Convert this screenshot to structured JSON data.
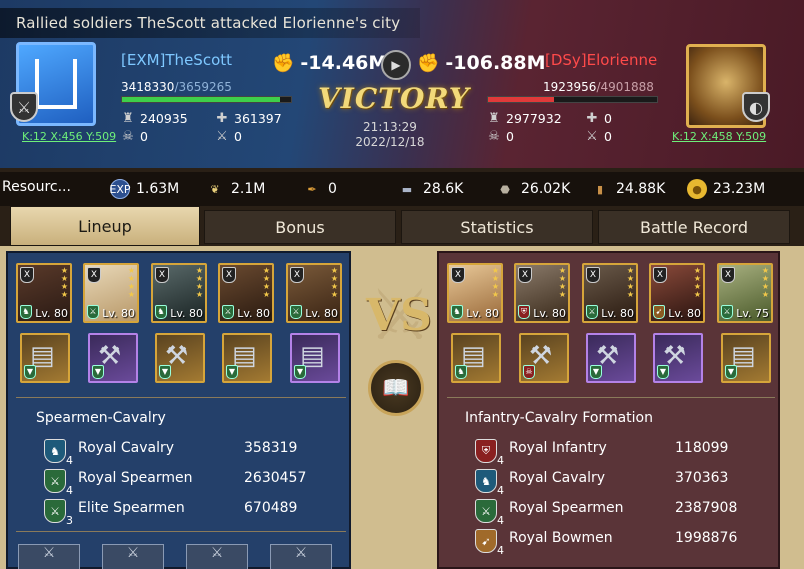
{
  "header": {
    "title": "Rallied soldiers TheScott attacked Elorienne's city",
    "result": "VICTORY",
    "time": "21:13:29",
    "date": "2022/12/18",
    "left": {
      "name": "[EXM]TheScott",
      "coord": "K:12 X:456 Y:509",
      "hp_current": "3418330",
      "hp_max": "/3659265",
      "hp_fraction": 0.934,
      "power": "-14.46M",
      "stat1": "240935",
      "stat2": "361397",
      "stat3": "0",
      "stat4": "0",
      "name_color": "#7ec8ff",
      "bar_color": "#3ecf4a"
    },
    "right": {
      "name": "[DSy]Elorienne",
      "coord": "K:12 X:458 Y:509",
      "hp_current": "1923956",
      "hp_max": "/4901888",
      "hp_fraction": 0.392,
      "power": "-106.88M",
      "stat1": "2977932",
      "stat2": "0",
      "stat3": "0",
      "stat4": "0",
      "name_color": "#ff4a4a",
      "bar_color": "#e03a3a"
    }
  },
  "resources": {
    "label": "Resourc...",
    "items": [
      {
        "icon": "exp-icon",
        "value": "1.63M"
      },
      {
        "icon": "laurel-icon",
        "value": "2.1M"
      },
      {
        "icon": "feather-icon",
        "value": "0"
      },
      {
        "icon": "iron-icon",
        "value": "28.6K"
      },
      {
        "icon": "stone-icon",
        "value": "26.02K"
      },
      {
        "icon": "wood-icon",
        "value": "24.88K"
      },
      {
        "icon": "gold-icon",
        "value": "23.23M"
      }
    ]
  },
  "tabs": [
    "Lineup",
    "Bonus",
    "Statistics",
    "Battle Record"
  ],
  "lineup": {
    "left": {
      "heroes": [
        {
          "level": "Lv. 80"
        },
        {
          "level": "Lv. 80"
        },
        {
          "level": "Lv. 80"
        },
        {
          "level": "Lv. 80"
        },
        {
          "level": "Lv. 80"
        }
      ],
      "formation": "Spearmen-Cavalry",
      "troops": [
        {
          "tier": "4",
          "name": "Royal Cavalry",
          "count": "358319",
          "icon": "cavalry-icon"
        },
        {
          "tier": "4",
          "name": "Royal Spearmen",
          "count": "2630457",
          "icon": "spearmen-icon"
        },
        {
          "tier": "3",
          "name": "Elite Spearmen",
          "count": "670489",
          "icon": "spearmen-icon"
        }
      ]
    },
    "right": {
      "heroes": [
        {
          "level": "Lv. 80"
        },
        {
          "level": "Lv. 80"
        },
        {
          "level": "Lv. 80"
        },
        {
          "level": "Lv. 80"
        },
        {
          "level": "Lv. 75"
        }
      ],
      "formation": "Infantry-Cavalry Formation",
      "troops": [
        {
          "tier": "4",
          "name": "Royal Infantry",
          "count": "118099",
          "icon": "infantry-icon"
        },
        {
          "tier": "4",
          "name": "Royal Cavalry",
          "count": "370363",
          "icon": "cavalry-icon"
        },
        {
          "tier": "4",
          "name": "Royal Spearmen",
          "count": "2387908",
          "icon": "spearmen-icon"
        },
        {
          "tier": "4",
          "name": "Royal Bowmen",
          "count": "1998876",
          "icon": "bowmen-icon"
        }
      ]
    },
    "vs": "VS"
  }
}
